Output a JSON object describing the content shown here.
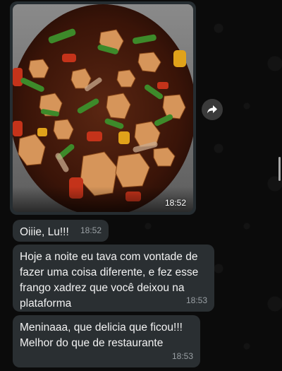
{
  "messages": [
    {
      "type": "image",
      "image_description_icon": "food-photo",
      "time": "18:52"
    },
    {
      "type": "text",
      "text": "Oiiie, Lu!!!",
      "time": "18:52"
    },
    {
      "type": "text",
      "text": "Hoje a noite eu tava com vontade de fazer uma coisa diferente, e fez esse frango xadrez que você deixou na plataforma",
      "time": "18:53"
    },
    {
      "type": "text",
      "text": "Meninaaa, que delicia que ficou!!! Melhor do que de restaurante",
      "time": "18:53"
    }
  ],
  "icons": {
    "forward": "forward-icon"
  },
  "colors": {
    "background": "#0b0b0b",
    "bubble": "#2a2f32",
    "time_text": "#9aa0a4"
  }
}
